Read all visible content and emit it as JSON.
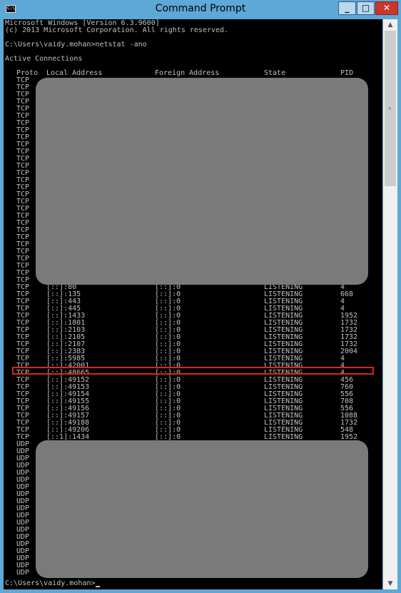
{
  "window": {
    "title": "Command Prompt",
    "minimize": "_",
    "maximize": "□",
    "close": "✕",
    "icon": "cmd-icon"
  },
  "console": {
    "header": [
      "Microsoft Windows [Version 6.3.9600]",
      "(c) 2013 Microsoft Corporation. All rights reserved.",
      "",
      "C:\\Users\\vaidy.mohan>netstat -ano",
      "",
      "Active Connections",
      ""
    ],
    "columns": [
      "Proto",
      "Local Address",
      "Foreign Address",
      "State",
      "PID"
    ],
    "top_redacted_count": 29,
    "rows": [
      [
        "TCP",
        "[::]:80",
        "[::]:0",
        "LISTENING",
        "4"
      ],
      [
        "TCP",
        "[::]:135",
        "[::]:0",
        "LISTENING",
        "668"
      ],
      [
        "TCP",
        "[::]:443",
        "[::]:0",
        "LISTENING",
        "4"
      ],
      [
        "TCP",
        "[::]:445",
        "[::]:0",
        "LISTENING",
        "4"
      ],
      [
        "TCP",
        "[::]:1433",
        "[::]:0",
        "LISTENING",
        "1952"
      ],
      [
        "TCP",
        "[::]:1801",
        "[::]:0",
        "LISTENING",
        "1732"
      ],
      [
        "TCP",
        "[::]:2103",
        "[::]:0",
        "LISTENING",
        "1732"
      ],
      [
        "TCP",
        "[::]:2105",
        "[::]:0",
        "LISTENING",
        "1732"
      ],
      [
        "TCP",
        "[::]:2107",
        "[::]:0",
        "LISTENING",
        "1732"
      ],
      [
        "TCP",
        "[::]:2383",
        "[::]:0",
        "LISTENING",
        "2004"
      ],
      [
        "TCP",
        "[::]:5985",
        "[::]:0",
        "LISTENING",
        "4"
      ],
      [
        "TCP",
        "[::]:42001",
        "[::]:0",
        "LISTENING",
        "4"
      ],
      [
        "TCP",
        "[::]:48665",
        "[::]:0",
        "LISTENING",
        "4"
      ],
      [
        "TCP",
        "[::]:49152",
        "[::]:0",
        "LISTENING",
        "456"
      ],
      [
        "TCP",
        "[::]:49153",
        "[::]:0",
        "LISTENING",
        "760"
      ],
      [
        "TCP",
        "[::]:49154",
        "[::]:0",
        "LISTENING",
        "556"
      ],
      [
        "TCP",
        "[::]:49155",
        "[::]:0",
        "LISTENING",
        "708"
      ],
      [
        "TCP",
        "[::]:49156",
        "[::]:0",
        "LISTENING",
        "556"
      ],
      [
        "TCP",
        "[::]:49157",
        "[::]:0",
        "LISTENING",
        "1088"
      ],
      [
        "TCP",
        "[::]:49188",
        "[::]:0",
        "LISTENING",
        "1732"
      ],
      [
        "TCP",
        "[::]:49206",
        "[::]:0",
        "LISTENING",
        "548"
      ],
      [
        "TCP",
        "[::1]:1434",
        "[::]:0",
        "LISTENING",
        "1952"
      ]
    ],
    "highlighted_row": "[::]:48665",
    "udp_label": "UDP",
    "udp_redacted_count": 19,
    "prompt": "C:\\Users\\vaidy.mohan>"
  },
  "colors": {
    "console_bg": "#000000",
    "console_text": "#c0c0c0",
    "title_bar": "#5ea8d8",
    "highlight_border": "#d9261c",
    "redaction": "#7a7a7a"
  }
}
